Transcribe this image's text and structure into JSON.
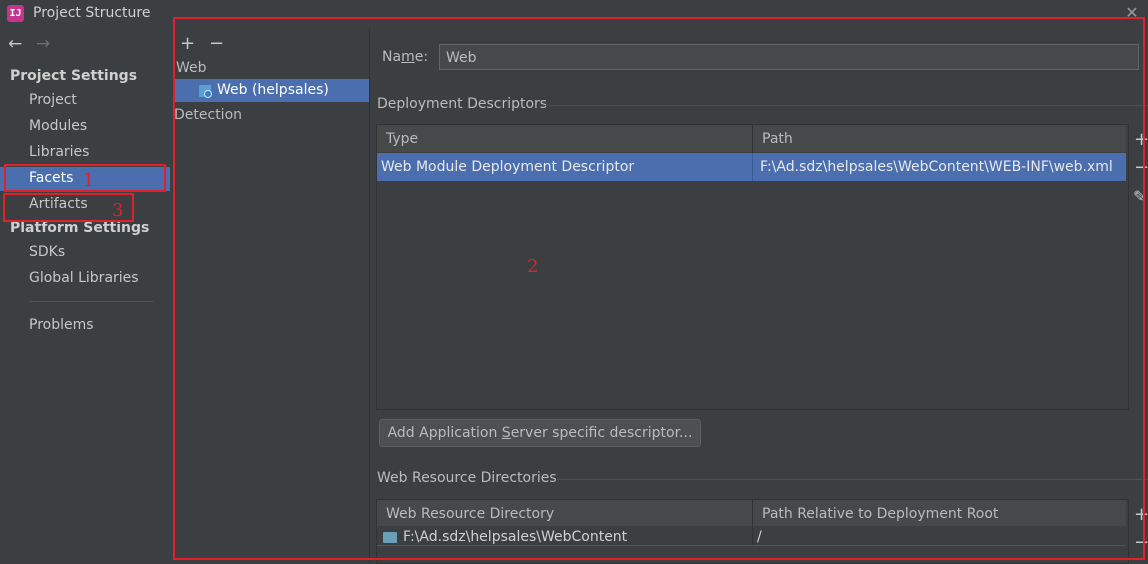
{
  "window": {
    "title": "Project Structure",
    "close_glyph": "✕",
    "icon_label": "IJ"
  },
  "nav": {
    "back_glyph": "←",
    "forward_glyph": "→",
    "project_settings_header": "Project Settings",
    "project_items": [
      "Project",
      "Modules",
      "Libraries",
      "Facets",
      "Artifacts"
    ],
    "platform_settings_header": "Platform Settings",
    "platform_items": [
      "SDKs",
      "Global Libraries"
    ],
    "problems": "Problems",
    "selected": "Facets"
  },
  "facet_tree": {
    "add_glyph": "+",
    "remove_glyph": "−",
    "group_label": "Web",
    "items": [
      {
        "label": "Web (helpsales)",
        "icon": "web-facet-icon",
        "selected": true
      }
    ],
    "detection_label": "Detection"
  },
  "facet_details": {
    "name_label_pre": "Na",
    "name_label_mnemonic": "m",
    "name_label_post": "e:",
    "name_value": "Web",
    "deployment_descriptors": {
      "section_title": "Deployment Descriptors",
      "columns": [
        "Type",
        "Path"
      ],
      "rows": [
        {
          "type": "Web Module Deployment Descriptor",
          "path": "F:\\Ad.sdz\\helpsales\\WebContent\\WEB-INF\\web.xml",
          "selected": true
        }
      ],
      "tools": {
        "add": "+",
        "remove": "−",
        "edit": "✎"
      }
    },
    "add_server_descriptor_pre": "Add Application ",
    "add_server_descriptor_mnemonic": "S",
    "add_server_descriptor_post": "erver specific descriptor...",
    "web_resource_directories": {
      "section_title": "Web Resource Directories",
      "columns": [
        "Web Resource Directory",
        "Path Relative to Deployment Root"
      ],
      "rows": [
        {
          "directory": "F:\\Ad.sdz\\helpsales\\WebContent",
          "relative_path": "/"
        }
      ],
      "tools": {
        "add": "+",
        "remove": "−"
      }
    }
  },
  "annotations": {
    "label_1": "1",
    "label_2": "2",
    "label_3": "3",
    "color": "#e0212b"
  },
  "theme": {
    "background": "#3c3f41",
    "selection": "#4b6eaf",
    "text": "#bbbbbb"
  }
}
